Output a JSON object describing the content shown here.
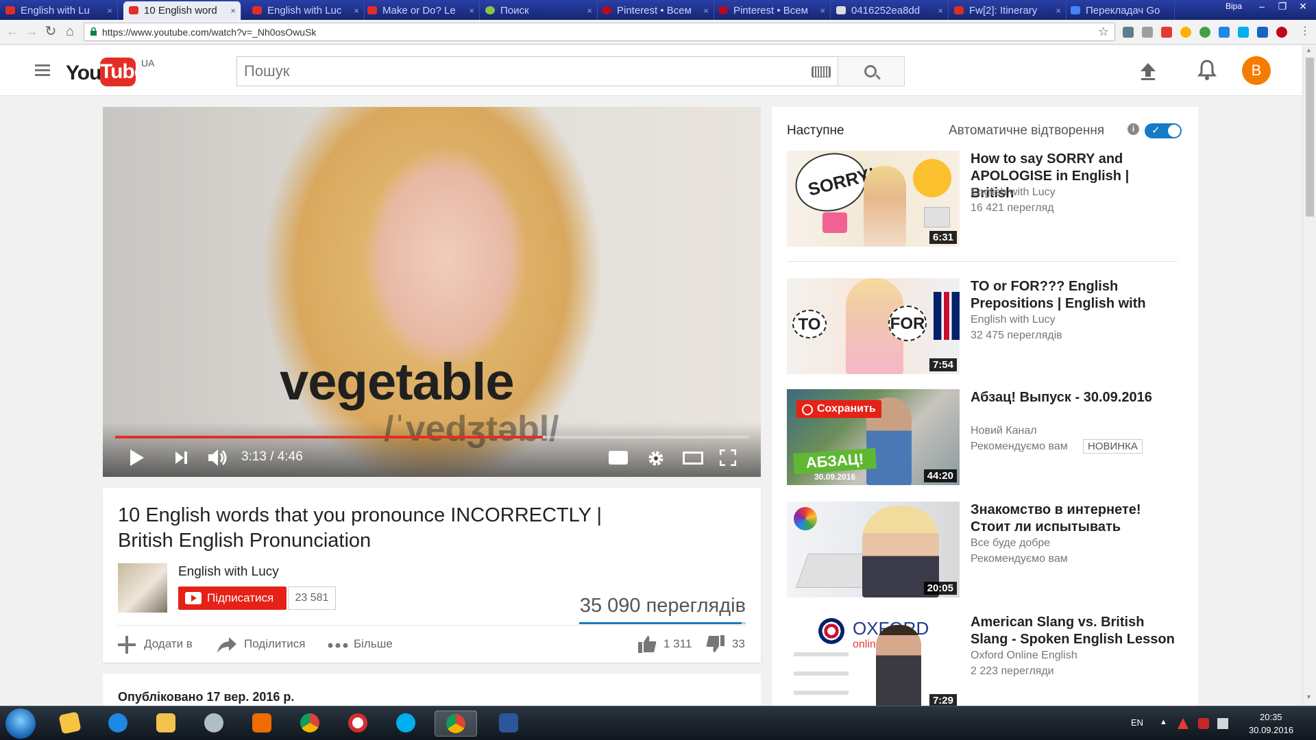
{
  "browser": {
    "tabs": [
      {
        "label": "English with Lu",
        "icon": "youtube-icon",
        "color": "#e52d27"
      },
      {
        "label": "10 English word",
        "icon": "youtube-icon",
        "color": "#e52d27",
        "active": true
      },
      {
        "label": "English with Luc",
        "icon": "youtube-icon",
        "color": "#e52d27"
      },
      {
        "label": "Make or Do? Le",
        "icon": "youtube-icon",
        "color": "#e52d27"
      },
      {
        "label": "Поиск",
        "icon": "search-engine-icon",
        "color": "#8bc34a"
      },
      {
        "label": "Pinterest • Всем",
        "icon": "pinterest-icon",
        "color": "#bd081c"
      },
      {
        "label": "Pinterest • Всем",
        "icon": "pinterest-icon",
        "color": "#bd081c"
      },
      {
        "label": "0416252ea8dd",
        "icon": "document-icon",
        "color": "#dddddd"
      },
      {
        "label": "Fw[2]: Itinerary",
        "icon": "gmail-icon",
        "color": "#d93025"
      },
      {
        "label": "Перекладач Go",
        "icon": "translate-icon",
        "color": "#4285f4"
      }
    ],
    "window_user": "Віра",
    "url": "https://www.youtube.com/watch?v=_Nh0osOwuSk"
  },
  "youtube": {
    "logo_you": "You",
    "logo_tube": "Tube",
    "logo_region": "UA",
    "search_placeholder": "Пошук",
    "avatar_letter": "В",
    "accent": "#e52d27"
  },
  "player": {
    "caption_word": "vegetable",
    "caption_phonetic": "/ˈvedʒtəbl/",
    "time_current": "3:13",
    "time_total": "4:46",
    "time_display": "3:13 / 4:46",
    "progress_fraction": 0.675,
    "buffer_fraction": 0.68
  },
  "video": {
    "title": "10 English words that you pronounce INCORRECTLY | British English Pronunciation",
    "channel": "English with Lucy",
    "subscribe_label": "Підписатися",
    "subscriber_count": "23 581",
    "views": "35 090 переглядів",
    "add_label": "Додати в",
    "share_label": "Поділитися",
    "more_label": "Більше",
    "likes": "1 311",
    "dislikes": "33",
    "like_fraction": 0.975,
    "published": "Опубліковано 17 вер. 2016 р."
  },
  "sidebar": {
    "up_next": "Наступне",
    "autoplay_label": "Автоматичне відтворення",
    "autoplay_on": true,
    "save_label": "Сохранить",
    "items": [
      {
        "title": "How to say SORRY and APOLOGISE in English | British",
        "channel": "English with Lucy",
        "meta": "16 421 перегляд",
        "duration": "6:31",
        "thumb_text": "SORRY!"
      },
      {
        "title": "TO or FOR??? English Prepositions | English with",
        "channel": "English with Lucy",
        "meta": "32 475 переглядів",
        "duration": "7:54",
        "thumb_text_left": "TO",
        "thumb_text_right": "FOR"
      },
      {
        "title": "Абзац! Выпуск - 30.09.2016",
        "channel": "Новий Канал",
        "meta": "Рекомендуємо вам",
        "badge": "НОВИНКА",
        "duration": "44:20",
        "thumb_text": "АБЗАЦ!",
        "thumb_date": "30.09.2016"
      },
      {
        "title": "Знакомство в интернете! Стоит ли испытывать",
        "channel": "Все буде добре",
        "meta": "Рекомендуємо вам",
        "duration": "20:05"
      },
      {
        "title": "American Slang vs. British Slang - Spoken English Lesson",
        "channel": "Oxford Online English",
        "meta": "2 223 перегляди",
        "duration": "7:29",
        "thumb_text": "OXFORD",
        "thumb_sub": "online e"
      }
    ]
  },
  "taskbar": {
    "language": "EN",
    "time": "20:35",
    "date": "30.09.2016"
  }
}
